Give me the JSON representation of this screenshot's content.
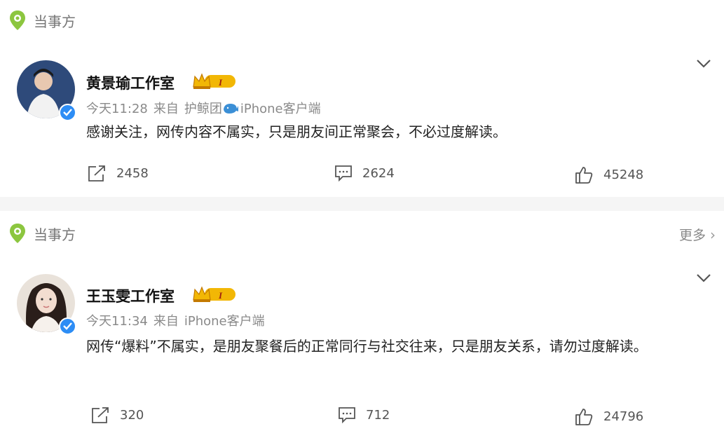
{
  "posts": [
    {
      "source_label": "当事方",
      "author": "黄景瑜工作室",
      "badge_level": "I",
      "time": "今天11:28",
      "from_prefix": "来自",
      "client": "护鲸团",
      "device": "iPhone客户端",
      "text": "感谢关注，网传内容不属实，只是朋友间正常聚会，不必过度解读。",
      "reposts": "2458",
      "comments": "2624",
      "likes": "45248"
    },
    {
      "source_label": "当事方",
      "more_label": "更多",
      "author": "王玉雯工作室",
      "badge_level": "I",
      "time": "今天11:34",
      "from_prefix": "来自",
      "device": "iPhone客户端",
      "text": "网传“爆料”不属实，是朋友聚餐后的正常同行与社交往来，只是朋友关系，请勿过度解读。",
      "reposts": "320",
      "comments": "712",
      "likes": "24796"
    }
  ],
  "colors": {
    "source_icon": "#8cc63f",
    "verify": "#2d8df5",
    "badge_gold": "#f2b705",
    "whale": "#3b8fd6"
  }
}
